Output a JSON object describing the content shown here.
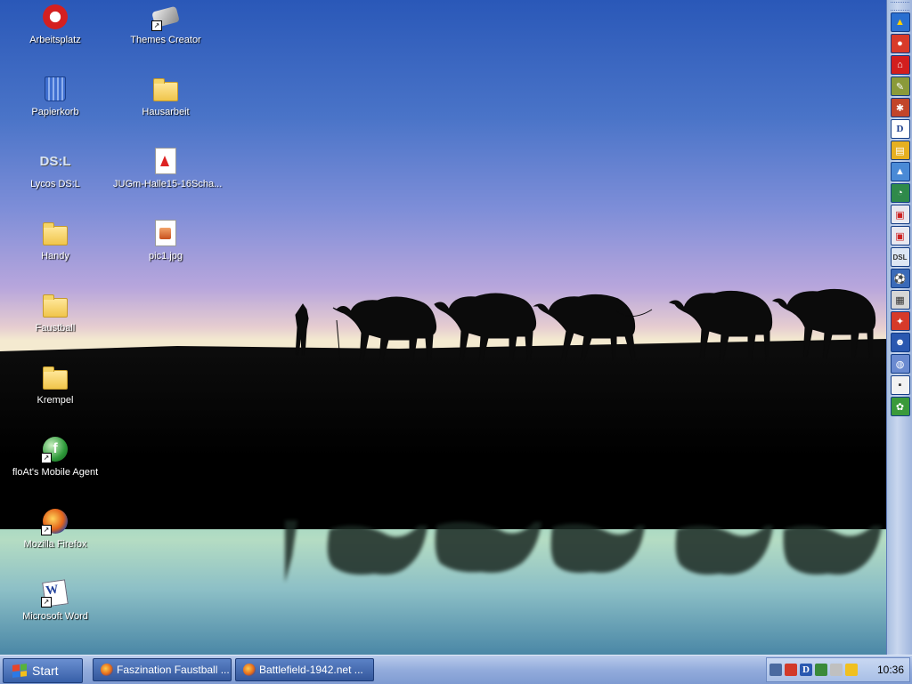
{
  "desktop_icons": [
    {
      "label": "Arbeitsplatz",
      "icon": "computer-icon"
    },
    {
      "label": "Themes Creator",
      "icon": "themes-creator-icon"
    },
    {
      "label": "Papierkorb",
      "icon": "recycle-bin-icon"
    },
    {
      "label": "Hausarbeit",
      "icon": "folder-icon"
    },
    {
      "label": "Lycos DS:L",
      "icon": "dsl-icon",
      "glyph_text": "DS:L"
    },
    {
      "label": "JUGm-Halle15-16Scha...",
      "icon": "pdf-document-icon"
    },
    {
      "label": "Handy",
      "icon": "folder-icon"
    },
    {
      "label": "pic1.jpg",
      "icon": "image-file-icon"
    },
    {
      "label": "Faustball",
      "icon": "folder-icon"
    },
    {
      "label": "Krempel",
      "icon": "folder-icon"
    },
    {
      "label": "floAt's Mobile Agent",
      "icon": "mobile-agent-icon"
    },
    {
      "label": "Mozilla Firefox",
      "icon": "firefox-icon"
    },
    {
      "label": "Microsoft Word",
      "icon": "word-icon"
    }
  ],
  "sidebar": {
    "buttons": [
      "warning",
      "stop",
      "pdf",
      "tools",
      "game",
      "D",
      "save",
      "hat",
      "clock",
      "stamp",
      "stamp2",
      "dsl",
      "soccer",
      "chart",
      "skype",
      "contact",
      "shield",
      "floppy",
      "flower"
    ],
    "d_label": "D"
  },
  "taskbar": {
    "start_label": "Start",
    "tasks": [
      {
        "label": "Faszination Faustball ...",
        "icon": "firefox-icon"
      },
      {
        "label": "Battlefield-1942.net ...",
        "icon": "firefox-icon"
      }
    ],
    "clock": "10:36"
  },
  "colors": {
    "sky_top": "#2a58b8",
    "taskbar": "#93acdc",
    "sidebar": "#c9d7ee"
  }
}
